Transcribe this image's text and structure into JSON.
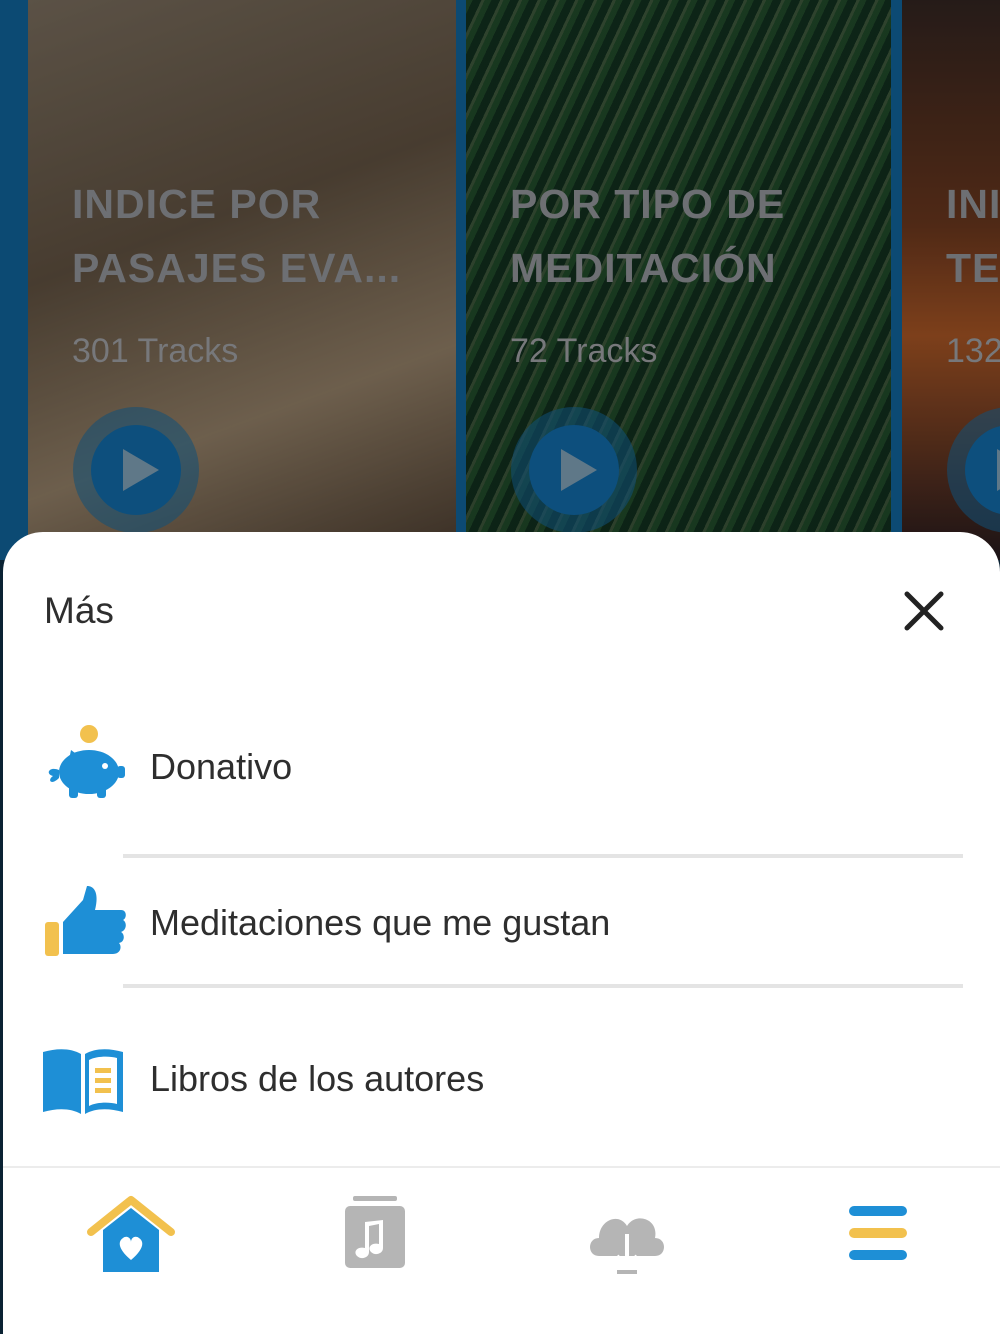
{
  "cards": [
    {
      "title": "INDICE POR\nPASAJES EVA...",
      "count": "301 Tracks"
    },
    {
      "title": "POR TIPO DE\nMEDITACIÓN",
      "count": "72 Tracks"
    },
    {
      "title": "INI\nTE",
      "count": "132"
    }
  ],
  "sheet": {
    "title": "Más",
    "items": [
      {
        "label": "Donativo",
        "icon": "piggy-bank-icon"
      },
      {
        "label": "Meditaciones que me gustan",
        "icon": "thumbs-up-icon"
      },
      {
        "label": "Libros de los autores",
        "icon": "book-icon"
      }
    ]
  },
  "nav": [
    {
      "icon": "home-icon",
      "active": true
    },
    {
      "icon": "music-icon",
      "active": false
    },
    {
      "icon": "cloud-download-icon",
      "active": false
    },
    {
      "icon": "menu-icon",
      "active": true
    }
  ],
  "colors": {
    "accent_blue": "#1e8fd6",
    "accent_yellow": "#f2c14e",
    "inactive_gray": "#b5b5b5",
    "text": "#2e2e2e"
  }
}
